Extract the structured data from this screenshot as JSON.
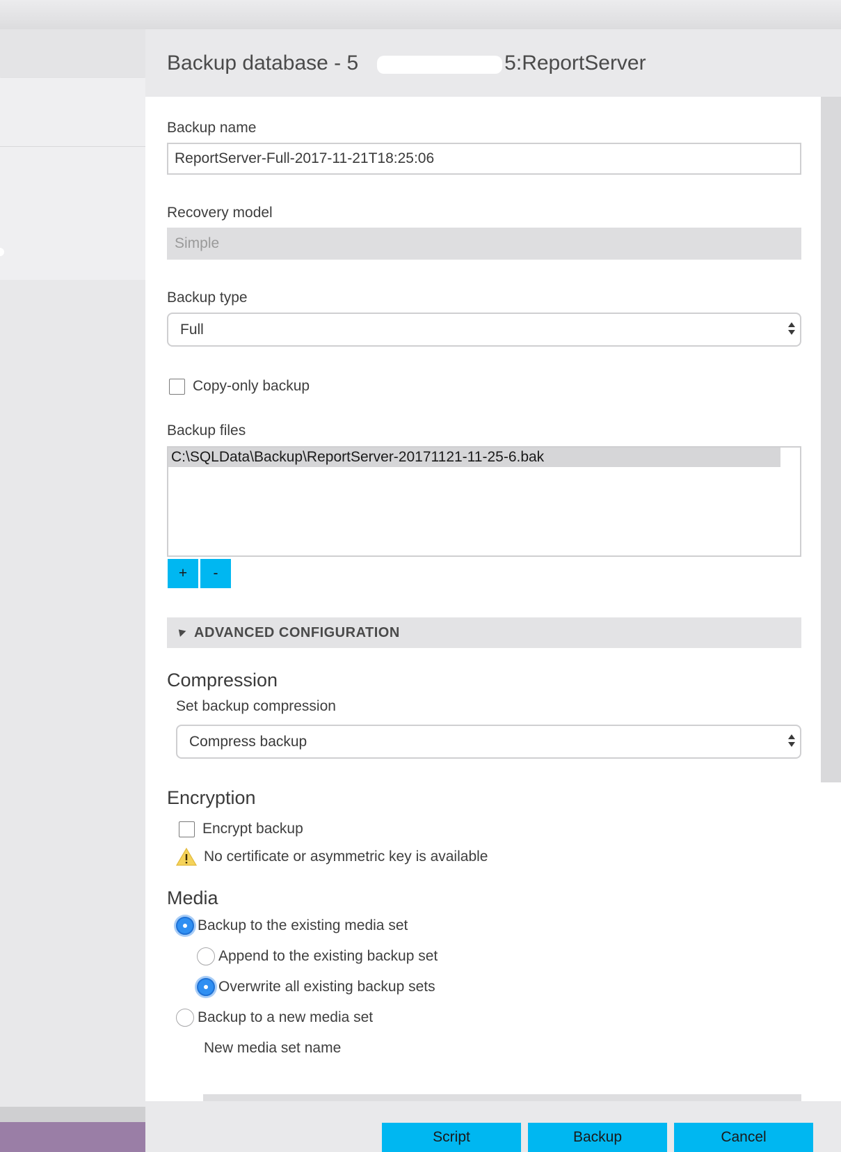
{
  "dialog": {
    "title": "Backup database - 5              5:ReportServer"
  },
  "form": {
    "backup_name_label": "Backup name",
    "backup_name_value": "ReportServer-Full-2017-11-21T18:25:06",
    "recovery_model_label": "Recovery model",
    "recovery_model_value": "Simple",
    "backup_type_label": "Backup type",
    "backup_type_value": "Full",
    "copy_only_label": "Copy-only backup",
    "backup_files_label": "Backup files",
    "backup_files": [
      "C:\\SQLData\\Backup\\ReportServer-20171121-11-25-6.bak"
    ],
    "add_label": "+",
    "remove_label": "-"
  },
  "advanced": {
    "header": "ADVANCED CONFIGURATION",
    "compression": {
      "title": "Compression",
      "set_label": "Set backup compression",
      "value": "Compress backup"
    },
    "encryption": {
      "title": "Encryption",
      "encrypt_label": "Encrypt backup",
      "warning": "No certificate or asymmetric key is available"
    },
    "media": {
      "title": "Media",
      "existing_media_label": "Backup to the existing media set",
      "append_label": "Append to the existing backup set",
      "overwrite_label": "Overwrite all existing backup sets",
      "new_media_label": "Backup to a new media set",
      "new_media_name_label": "New media set name"
    }
  },
  "footer": {
    "script_label": "Script",
    "backup_label": "Backup",
    "cancel_label": "Cancel"
  },
  "colors": {
    "accent": "#00b7f1",
    "radio_selected": "#2f8ff2",
    "warning": "#f5d35a"
  }
}
